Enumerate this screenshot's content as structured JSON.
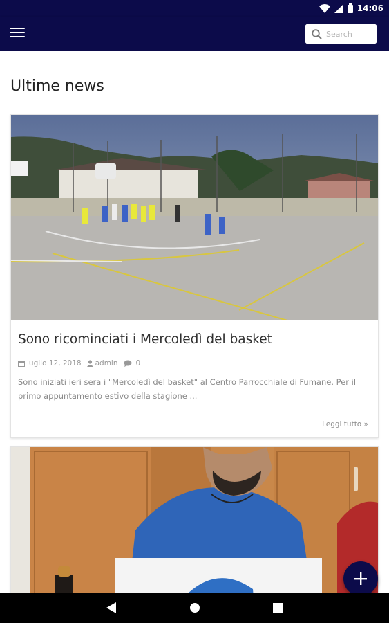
{
  "status_bar": {
    "time": "14:06",
    "icons": [
      "wifi-icon",
      "signal-icon",
      "battery-icon"
    ]
  },
  "toolbar": {
    "menu_icon": "hamburger-icon",
    "search": {
      "placeholder": "Search",
      "value": "",
      "icon": "search-icon"
    }
  },
  "section_title": "Ultime news",
  "posts": [
    {
      "title": "Sono ricominciati i Mercoledì del basket",
      "date": "luglio 12, 2018",
      "author": "admin",
      "comments": "0",
      "excerpt": "Sono iniziati ieri sera i \"Mercoledì del basket\" al Centro Parrocchiale di Fumane. Per il primo appuntamento estivo della stagione ...",
      "read_more": "Leggi tutto »"
    }
  ],
  "fab_icon": "plus-icon",
  "nav_icons": [
    "back-icon",
    "home-icon",
    "recents-icon"
  ],
  "colors": {
    "primary": "#0c0b4a",
    "text_muted": "#8a8a8a"
  }
}
